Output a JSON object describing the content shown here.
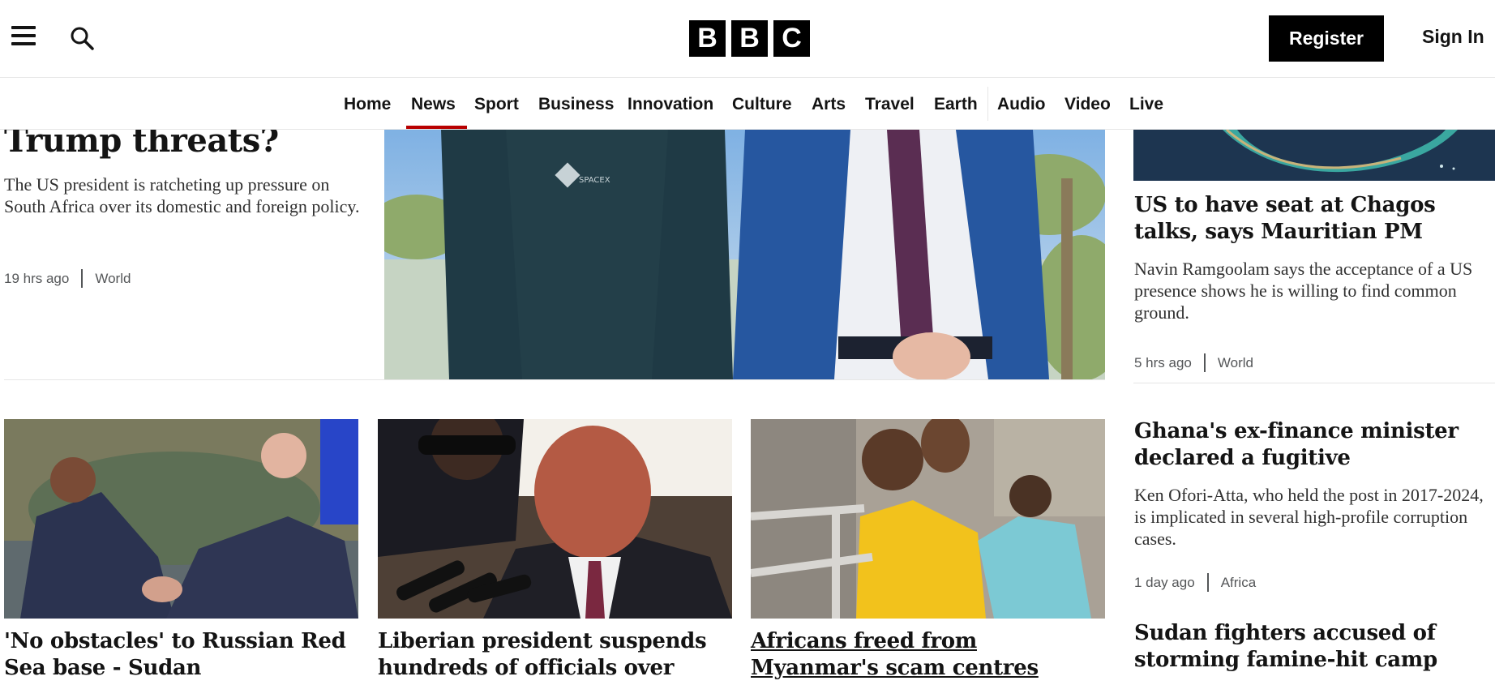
{
  "header": {
    "menu_icon": "hamburger-menu-icon",
    "search_icon": "search-icon",
    "logo": [
      "B",
      "B",
      "C"
    ],
    "register_label": "Register",
    "signin_label": "Sign In"
  },
  "nav": {
    "items": [
      {
        "label": "Home"
      },
      {
        "label": "News",
        "active": true
      },
      {
        "label": "Sport"
      },
      {
        "label": "Business"
      },
      {
        "label": "Innovation"
      },
      {
        "label": "Culture"
      },
      {
        "label": "Arts"
      },
      {
        "label": "Travel"
      },
      {
        "label": "Earth"
      },
      {
        "label": "Audio"
      },
      {
        "label": "Video"
      },
      {
        "label": "Live"
      }
    ],
    "active_color": "#b80000"
  },
  "lead_story": {
    "headline_partial": "Trump threats?",
    "summary": "The US president is ratcheting up pressure on South Africa over its domestic and foreign policy.",
    "time": "19 hrs ago",
    "section": "World"
  },
  "sidebar": {
    "stories": [
      {
        "headline": "US to have seat at Chagos talks, says Mauritian PM",
        "summary": "Navin Ramgoolam says the acceptance of a US presence shows he is willing to find common ground.",
        "time": "5 hrs ago",
        "section": "World"
      },
      {
        "headline": "Ghana's ex-finance minister declared a fugitive",
        "summary": "Ken Ofori-Atta, who held the post in 2017-2024, is implicated in several high-profile corruption cases.",
        "time": "1 day ago",
        "section": "Africa"
      },
      {
        "headline": "Sudan fighters accused of storming famine-hit camp"
      }
    ]
  },
  "cards": [
    {
      "headline": "'No obstacles' to Russian Red Sea base - Sudan"
    },
    {
      "headline": "Liberian president suspends hundreds of officials over asset"
    },
    {
      "headline": "Africans freed from Myanmar's scam centres"
    }
  ]
}
